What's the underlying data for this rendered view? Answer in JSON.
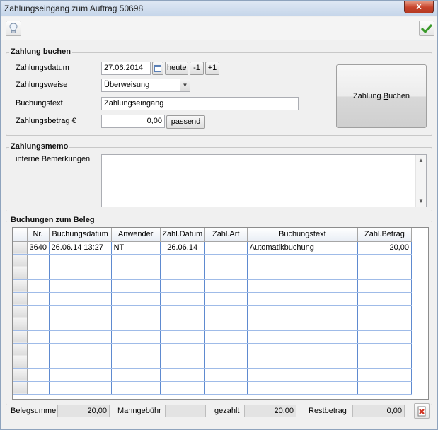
{
  "window": {
    "title": "Zahlungseingang zum Auftrag 50698",
    "close_label": "x"
  },
  "toolbar": {
    "info_icon": "lightbulb-icon",
    "ok_icon": "checkmark-icon"
  },
  "zahlung": {
    "legend": "Zahlung buchen",
    "datum_label_pre": "Zahlungs",
    "datum_label_u": "d",
    "datum_label_post": "atum",
    "datum_value": "27.06.2014",
    "heute_label": "heute",
    "minus_label": "-1",
    "plus_label": "+1",
    "weise_label_pre": "",
    "weise_label_u": "Z",
    "weise_label_post": "ahlungsweise",
    "weise_value": "Überweisung",
    "text_label": "Buchungstext",
    "text_value": "Zahlungseingang",
    "betrag_label_u": "Z",
    "betrag_label_post": "ahlungsbetrag €",
    "betrag_value": "0,00",
    "passend_label": "passend",
    "buchen_label_pre": "Zahlung ",
    "buchen_label_u": "B",
    "buchen_label_post": "uchen"
  },
  "memo": {
    "legend": "Zahlungsmemo",
    "label": "interne Bemerkungen",
    "value": ""
  },
  "buchungen": {
    "legend": "Buchungen zum Beleg",
    "columns": [
      "Nr.",
      "Buchungsdatum",
      "Anwender",
      "Zahl.Datum",
      "Zahl.Art",
      "Buchungstext",
      "Zahl.Betrag"
    ],
    "rows": [
      [
        "3640",
        "26.06.14 13:27",
        "NT",
        "26.06.14",
        "",
        "Automatikbuchung",
        "20,00"
      ]
    ],
    "empty_rows": 11
  },
  "footer": {
    "belegsumme_label": "Belegsumme",
    "belegsumme_value": "20,00",
    "mahn_label": "Mahngebühr",
    "mahn_value": "",
    "gezahlt_label": "gezahlt",
    "gezahlt_value": "20,00",
    "rest_label": "Restbetrag",
    "rest_value": "0,00"
  }
}
